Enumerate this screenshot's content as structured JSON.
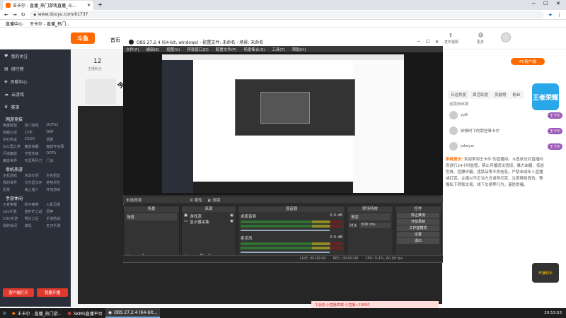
{
  "browser": {
    "tab_title": "王卡尔 - 直播_热门游戏直播_斗...",
    "url": "www.douyu.com/61737",
    "bookmarks": [
      "直播中心",
      "王卡尔 - 直播_热门..."
    ]
  },
  "site": {
    "logo_text": "斗鱼",
    "nav_home": "首页",
    "header_icons": [
      "发布视频",
      "更多"
    ],
    "pc_button": "PC客户端",
    "count": "12",
    "count_label": "主播粉丝",
    "streamer_title": "今"
  },
  "sidebar": {
    "top_items": [
      "我的关注",
      "排行榜",
      "贡献中心",
      "云游戏",
      "赛事"
    ],
    "categories": [
      {
        "title": "网游竞技",
        "items": [
          "英雄联盟",
          "热门游戏",
          "DOTA2",
          "穿越火线",
          "CF手",
          "DNF",
          "炉石传说",
          "CSGO",
          "逃跑",
          "fd三国之类",
          "魔兽争霸",
          "魔兽怀旧服",
          "问道魔兽",
          "守望先锋",
          "DOTA",
          "魔兽世界",
          "天涯明月刀",
          "门派"
        ]
      },
      {
        "title": "单机热游",
        "items": [
          "主机游戏",
          "永劫无间",
          "生死狙击",
          "我的世界",
          "艾尔登法环",
          "绝地求生",
          "饥荒",
          "海上猎人",
          "怀旧游戏"
        ]
      },
      {
        "title": "手游休闲",
        "items": [
          "王者荣耀",
          "和平精英",
          "火影忍者",
          "LOL手游",
          "金铲铲之战",
          "原神",
          "CDO手游",
          "明日之后",
          "手游枪战",
          "我的休闲",
          "单机",
          "天刀手游"
        ]
      }
    ],
    "btn_client": "客户端打开",
    "btn_live": "我要开播"
  },
  "obs": {
    "title": "OBS 27.2.4 (64-bit, windows) - 配置文件: 未命名 - 场景: 未命名",
    "menu": [
      "文件(F)",
      "编辑(E)",
      "视图(V)",
      "停靠窗口(D)",
      "配置文件(P)",
      "场景集合(S)",
      "工具(T)",
      "帮助(H)"
    ],
    "status_strip": [
      "未选择源",
      "属性",
      "滤镜"
    ],
    "docks": {
      "scenes": {
        "title": "场景",
        "items": [
          "场景"
        ]
      },
      "sources": {
        "title": "来源",
        "items": [
          "游戏源",
          "显示器采集"
        ]
      },
      "mixer": {
        "title": "混音器",
        "channels": [
          {
            "name": "桌面音频",
            "level": "0.0 dB"
          },
          {
            "name": "麦克风",
            "level": "0.0 dB"
          }
        ]
      },
      "transitions": {
        "title": "转场特效",
        "type": "渐变",
        "duration_label": "时长",
        "duration": "300 ms"
      },
      "controls": {
        "title": "控件",
        "buttons": [
          "停止推流",
          "开始录制",
          "工作室模式",
          "设置",
          "退出"
        ]
      }
    },
    "statusbar": [
      "LIVE: 00:00:00",
      "REC: 00:00:00",
      "CPU: 0.4%, 60.00 fps"
    ]
  },
  "right_panel": {
    "tabs": [
      "日运势度",
      "周活跃度",
      "贡献榜",
      "粉丝"
    ],
    "list_title": "送我粉丝数",
    "rows": [
      {
        "name": "yy8",
        "badge": "王卡尔"
      },
      {
        "name": "钟情时下的那些事卡尔",
        "badge": "王卡尔"
      },
      {
        "name": "jokeyw",
        "badge": "王卡尔"
      }
    ],
    "notice_label": "系统提示:",
    "notice_text": "欢迎来到王卡尔 的直播间。斗鱼依法对直播内容进行24小时监管，禁止传播违法违规、暴力血腥、低俗色情、招嫖诈骗、违禁品等不良信息。严禁未成年人直播或打赏。主播以不正当方式诱导打赏、注意辨别真伪、警惕私下转账交易、线下交易等行为，谨防受骗。",
    "banner_text": "王者荣耀",
    "badge_text": "开播助手",
    "bottom_promo": "1活动  小直播高端·小直播+10000"
  },
  "taskbar": {
    "items": [
      "王卡尔 - 直播_热门游...",
      "SKMS直播平台",
      "OBS 27.2.4 (64-bit..."
    ],
    "clock": "20:53:53"
  }
}
